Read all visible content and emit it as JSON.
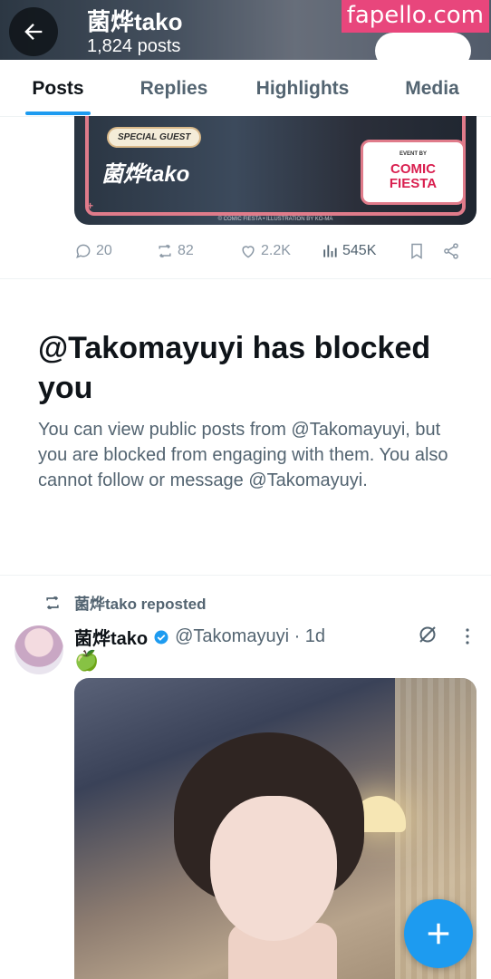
{
  "watermark": "fapello.com",
  "header": {
    "name": "菌烨tako",
    "posts_count": "1,824 posts"
  },
  "tabs": [
    {
      "label": "Posts",
      "active": true
    },
    {
      "label": "Replies",
      "active": false
    },
    {
      "label": "Highlights",
      "active": false
    },
    {
      "label": "Media",
      "active": false
    }
  ],
  "banner": {
    "guest_label": "SPECIAL GUEST",
    "name": "菌烨tako",
    "event_small": "EVENT BY",
    "event_title_line1": "COMIC",
    "event_title_line2": "FIESTA",
    "credit": "© COMIC FIESTA • ILLUSTRATION BY KO-MA"
  },
  "engagement": {
    "replies": "20",
    "reposts": "82",
    "likes": "2.2K",
    "views": "545K"
  },
  "blocked": {
    "title": "@Takomayuyi has blocked you",
    "body": "You can view public posts from @Takomayuyi, but you are blocked from engaging with them. You also cannot follow or message @Takomayuyi."
  },
  "repost": {
    "label": "菌烨tako reposted",
    "name": "菌烨tako",
    "handle_time": "@Takomayuyi · 1d",
    "text": "🍏"
  },
  "colors": {
    "accent": "#1d9bf0",
    "text_primary": "#0f1419",
    "text_secondary": "#536471",
    "watermark_bg": "#e8467c"
  }
}
